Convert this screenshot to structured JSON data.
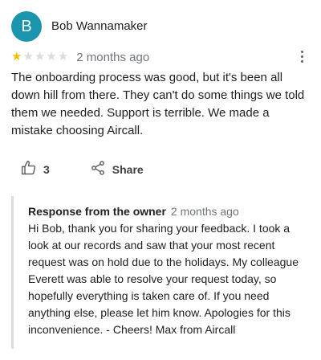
{
  "reviewer": {
    "avatar_letter": "B",
    "avatar_color": "#1b95ad",
    "name": "Bob Wannamaker"
  },
  "review": {
    "rating": 1,
    "max_rating": 5,
    "star_icon": "star-icon",
    "star_filled_color": "#fbbc04",
    "star_empty_color": "#dadce0",
    "date": "2 months ago",
    "more_icon": "more-vert-icon",
    "text": "The onboarding process was good, but it's been all down hill from there. They can't do some things we told them we needed. Support is terrible. We made a mistake choosing Aircall."
  },
  "actions": {
    "like_icon": "thumbs-up-icon",
    "like_count": "3",
    "share_icon": "share-icon",
    "share_label": "Share"
  },
  "owner_response": {
    "title": "Response from the owner",
    "date": "2 months ago",
    "text": "Hi Bob, thank you for sharing your feedback. I took a look at our records and saw that your most recent request was on hold due to the holidays. My colleague Everett was able to resolve your request today, so hopefully everything is taken care of. If you need anything else, please let him know. Apologies for this inconvenience. - Cheers! Max from Aircall"
  }
}
